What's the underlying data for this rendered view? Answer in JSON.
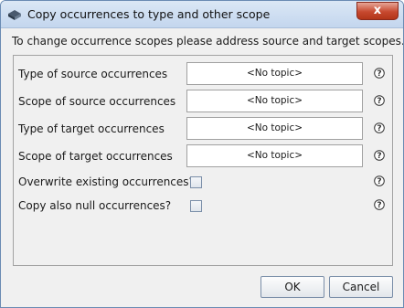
{
  "window": {
    "title": "Copy occurrences to type and other scope",
    "close_glyph": "x"
  },
  "info_text": "To change occurrence scopes please address source and target scopes.",
  "fields": [
    {
      "label": "Type of source occurrences",
      "value": "<No topic>"
    },
    {
      "label": "Scope of source occurrences",
      "value": "<No topic>"
    },
    {
      "label": "Type of target occurrences",
      "value": "<No topic>"
    },
    {
      "label": "Scope of target occurrences",
      "value": "<No topic>"
    }
  ],
  "options": [
    {
      "label": "Overwrite existing occurrences?",
      "checked": false
    },
    {
      "label": "Copy also null occurrences?",
      "checked": false
    }
  ],
  "buttons": {
    "ok": "OK",
    "cancel": "Cancel"
  }
}
